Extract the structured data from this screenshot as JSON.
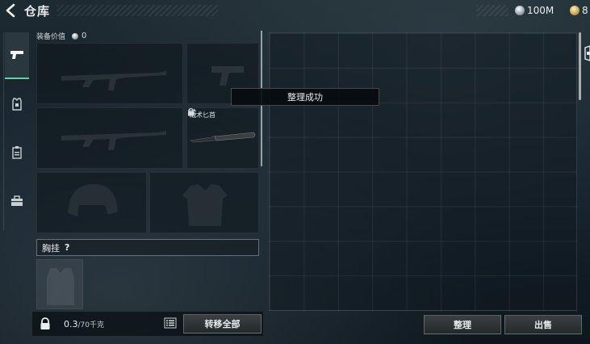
{
  "header": {
    "title": "仓库",
    "currencies": [
      {
        "icon": "silver-coin-icon",
        "amount": "100M"
      },
      {
        "icon": "gold-coin-icon",
        "amount": "8"
      }
    ]
  },
  "tabs": [
    {
      "name": "weapons",
      "icon": "pistol-icon",
      "active": true
    },
    {
      "name": "armor",
      "icon": "armor-vest-icon",
      "active": false
    },
    {
      "name": "backpack",
      "icon": "clipboard-icon",
      "active": false
    },
    {
      "name": "supplies",
      "icon": "case-icon",
      "active": false
    }
  ],
  "equipment": {
    "value_label": "装备价值",
    "value_icon": "silver-coin-icon",
    "value": "0",
    "knife_label": "战术匕首",
    "rig_label": "胸挂",
    "rig_help": "?"
  },
  "bottom_left": {
    "weight_value": "0.3",
    "weight_capacity": "/70千克",
    "transfer_all_label": "转移全部"
  },
  "bottom_right": {
    "sort_label": "整理",
    "sell_label": "出售"
  },
  "toast": {
    "message": "整理成功"
  },
  "colors": {
    "accent": "#5fd3a8",
    "background": "#14202a",
    "button": "#2f3538"
  }
}
